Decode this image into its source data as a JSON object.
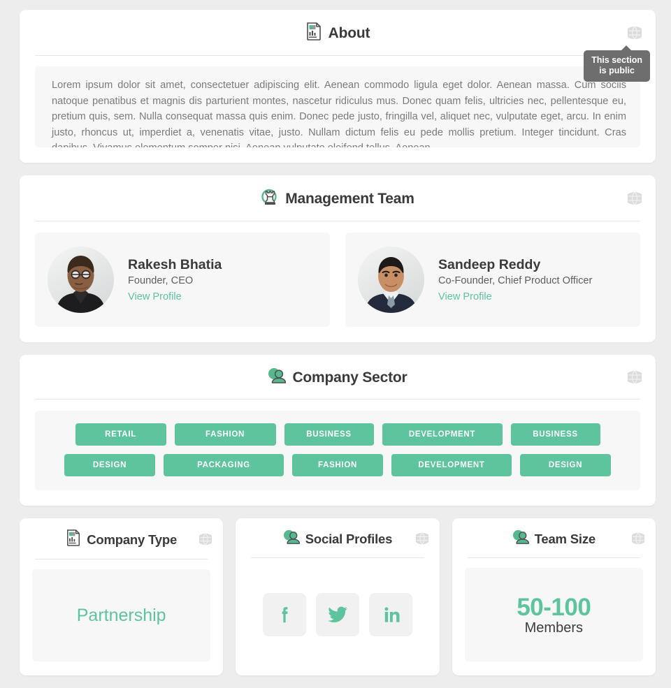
{
  "theme": {
    "accent": "#5ec49e",
    "page_bg": "#ededed",
    "card_bg": "#ffffff",
    "panel_bg": "#f7f7f7",
    "tooltip_bg": "#6e6e6e"
  },
  "about": {
    "title": "About",
    "icon": "report-document-icon",
    "visibility_icon": "globe-icon",
    "tooltip": "This section\nis public",
    "body": "Lorem ipsum dolor sit amet, consectetuer adipiscing elit. Aenean commodo ligula eget dolor. Aenean massa. Cum sociis natoque penatibus et magnis dis parturient montes, nascetur ridiculus mus. Donec quam felis, ultricies nec, pellentesque eu, pretium quis, sem. Nulla consequat massa quis enim. Donec pede justo, fringilla vel, aliquet nec, vulputate eget, arcu. In enim justo, rhoncus ut, imperdiet a, venenatis vitae, justo. Nullam dictum felis eu pede mollis pretium. Integer tincidunt. Cras dapibus. Vivamus elementum semper nisi. Aenean vulputate eleifend tellus. Aenean"
  },
  "management_team": {
    "title": "Management Team",
    "icon": "rook-tower-icon",
    "visibility_icon": "globe-icon",
    "members": [
      {
        "name": "Rakesh Bhatia",
        "role": "Founder, CEO",
        "link_label": "View Profile",
        "avatar": "avatar-rakesh-bhatia"
      },
      {
        "name": "Sandeep Reddy",
        "role": "Co-Founder, Chief Product Officer",
        "link_label": "View Profile",
        "avatar": "avatar-sandeep-reddy"
      }
    ]
  },
  "company_sector": {
    "title": "Company Sector",
    "icon": "user-profile-icon",
    "visibility_icon": "globe-icon",
    "rows": [
      [
        "RETAIL",
        "FASHION",
        "BUSINESS",
        "DEVELOPMENT",
        "BUSINESS"
      ],
      [
        "DESIGN",
        "PACKAGING",
        "FASHION",
        "DEVELOPMENT",
        "DESIGN"
      ]
    ]
  },
  "company_type": {
    "title": "Company Type",
    "icon": "report-document-icon",
    "visibility_icon": "globe-icon",
    "value": "Partnership"
  },
  "social_profiles": {
    "title": "Social Profiles",
    "icon": "user-profile-icon",
    "visibility_icon": "globe-icon",
    "profiles": [
      {
        "name": "facebook",
        "label": "f"
      },
      {
        "name": "twitter",
        "label": "twitter"
      },
      {
        "name": "linkedin",
        "label": "in"
      }
    ]
  },
  "team_size": {
    "title": "Team Size",
    "icon": "user-profile-icon",
    "visibility_icon": "globe-icon",
    "count": "50-100",
    "unit": "Members"
  }
}
